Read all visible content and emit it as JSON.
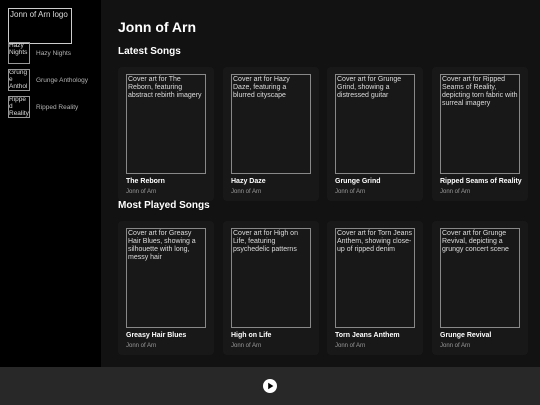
{
  "sidebar": {
    "logo_alt": "Jonn of Arn logo",
    "items": [
      {
        "thumb_alt": "Hazy Nights",
        "label": "Hazy Nights"
      },
      {
        "thumb_alt": "Grunge Anthology",
        "label": "Grunge Anthology"
      },
      {
        "thumb_alt": "Ripped Reality",
        "label": "Ripped Reality"
      }
    ]
  },
  "main": {
    "artist": "Jonn of Arn",
    "latest": {
      "title": "Latest Songs",
      "songs": [
        {
          "cover_alt": "Cover art for The Reborn, featuring abstract rebirth imagery",
          "title": "The Reborn",
          "artist": "Jonn of Arn"
        },
        {
          "cover_alt": "Cover art for Hazy Daze, featuring a blurred cityscape",
          "title": "Hazy Daze",
          "artist": "Jonn of Arn"
        },
        {
          "cover_alt": "Cover art for Grunge Grind, showing a distressed guitar",
          "title": "Grunge Grind",
          "artist": "Jonn of Arn"
        },
        {
          "cover_alt": "Cover art for Ripped Seams of Reality, depicting torn fabric with surreal imagery",
          "title": "Ripped Seams of Reality",
          "artist": "Jonn of Arn"
        }
      ]
    },
    "most_played": {
      "title": "Most Played Songs",
      "songs": [
        {
          "cover_alt": "Cover art for Greasy Hair Blues, showing a silhouette with long, messy hair",
          "title": "Greasy Hair Blues",
          "artist": "Jonn of Arn"
        },
        {
          "cover_alt": "Cover art for High on Life, featuring psychedelic patterns",
          "title": "High on Life",
          "artist": "Jonn of Arn"
        },
        {
          "cover_alt": "Cover art for Torn Jeans Anthem, showing close-up of ripped denim",
          "title": "Torn Jeans Anthem",
          "artist": "Jonn of Arn"
        },
        {
          "cover_alt": "Cover art for Grunge Revival, depicting a grungy concert scene",
          "title": "Grunge Revival",
          "artist": "Jonn of Arn"
        }
      ]
    }
  },
  "player": {
    "play_icon": "play-icon"
  }
}
